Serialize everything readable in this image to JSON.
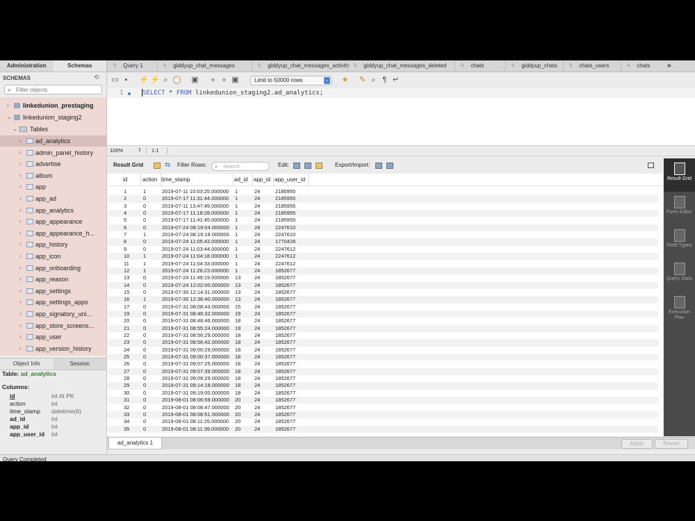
{
  "sidebar": {
    "tabs": [
      "Administration",
      "Schemas"
    ],
    "schemas_header": "SCHEMAS",
    "filter_placeholder": "Filter objects",
    "schemas": [
      "linkedunion_prestaging",
      "linkedunion_staging2"
    ],
    "tables_label": "Tables",
    "tables": [
      "ad_analytics",
      "admin_panel_history",
      "advertise",
      "album",
      "app",
      "app_ad",
      "app_analytics",
      "app_appearance",
      "app_appearance_h...",
      "app_history",
      "app_icon",
      "app_onboarding",
      "app_reason",
      "app_settings",
      "app_settings_apps",
      "app_signatory_uni...",
      "app_store_screens...",
      "app_user",
      "app_version_history"
    ],
    "selected_table": "ad_analytics"
  },
  "info": {
    "tabs": [
      "Object Info",
      "Session"
    ],
    "table_label": "Table:",
    "table_name": "ad_analytics",
    "columns_label": "Columns:",
    "columns": [
      {
        "name": "id",
        "type": "int AI PK"
      },
      {
        "name": "action",
        "type": "int"
      },
      {
        "name": "time_stamp",
        "type": "datetime(6)"
      },
      {
        "name": "ad_id",
        "type": "int"
      },
      {
        "name": "app_id",
        "type": "int"
      },
      {
        "name": "app_user_id",
        "type": "int"
      }
    ]
  },
  "query_tabs": [
    "Query 1",
    "giddyup_chat_messages",
    "giddyup_chat_messages_activity",
    "giddyup_chat_messages_deleted",
    "chats",
    "giddyup_chats",
    "chats_users",
    "chats"
  ],
  "more_tabs_glyph": "»",
  "toolbar": {
    "limit_label": "Limit to 50000 rows"
  },
  "editor": {
    "line_number": "1",
    "sql_keyword1": "SELECT",
    "sql_star": " * ",
    "sql_keyword2": "FROM",
    "sql_rest": " linkedunion_staging2.ad_analytics;"
  },
  "editor_status": {
    "zoom": "100%",
    "position": "1:1"
  },
  "result_toolbar": {
    "result_grid": "Result Grid",
    "filter_rows": "Filter Rows:",
    "search_placeholder": "Search",
    "edit": "Edit:",
    "export_import": "Export/Import:"
  },
  "right_panel": [
    {
      "label": "Result Grid",
      "icon": "result-grid-icon"
    },
    {
      "label": "Form Editor",
      "icon": "form-editor-icon"
    },
    {
      "label": "Field Types",
      "icon": "field-types-icon"
    },
    {
      "label": "Query Stats",
      "icon": "query-stats-icon"
    },
    {
      "label": "Execution Plan",
      "icon": "execution-plan-icon"
    }
  ],
  "grid": {
    "columns": [
      "id",
      "action",
      "time_stamp",
      "ad_id",
      "app_id",
      "app_user_id"
    ],
    "rows": [
      [
        "1",
        "1",
        "2019-07-11 10:03:25.000000",
        "1",
        "24",
        "2185955"
      ],
      [
        "2",
        "0",
        "2019-07-17 11:31:44.000000",
        "1",
        "24",
        "2185955"
      ],
      [
        "3",
        "0",
        "2019-07-11 13:47:49.000000",
        "1",
        "24",
        "2185955"
      ],
      [
        "4",
        "0",
        "2019-07-17 11:18:28.000000",
        "1",
        "24",
        "2185955"
      ],
      [
        "5",
        "0",
        "2019-07-17 11:41:45.000000",
        "1",
        "24",
        "2185955"
      ],
      [
        "6",
        "0",
        "2019-07-24 08:19:04.000000",
        "1",
        "24",
        "2247610"
      ],
      [
        "7",
        "1",
        "2019-07-24 08:19:18.000000",
        "1",
        "24",
        "2247610"
      ],
      [
        "8",
        "0",
        "2019-07-24 11:05:43.000000",
        "1",
        "24",
        "1770428"
      ],
      [
        "9",
        "0",
        "2019-07-24 11:03:44.000000",
        "1",
        "24",
        "2247612"
      ],
      [
        "10",
        "1",
        "2019-07-24 11:04:18.000000",
        "1",
        "24",
        "2247612"
      ],
      [
        "11",
        "1",
        "2019-07-24 11:04:33.000000",
        "1",
        "24",
        "2247612"
      ],
      [
        "12",
        "1",
        "2019-07-24 11:26:23.000000",
        "1",
        "24",
        "1852677"
      ],
      [
        "13",
        "0",
        "2019-07-24 11:49:19.000000",
        "13",
        "24",
        "1852677"
      ],
      [
        "14",
        "0",
        "2019-07-24 12:02:00.000000",
        "13",
        "24",
        "1852677"
      ],
      [
        "15",
        "0",
        "2019-07-30 12:14:31.000000",
        "13",
        "24",
        "1852677"
      ],
      [
        "16",
        "1",
        "2019-07-30 12:36:40.000000",
        "13",
        "24",
        "1852677"
      ],
      [
        "17",
        "0",
        "2019-07-31 08:08:43.000000",
        "15",
        "24",
        "1852677"
      ],
      [
        "19",
        "0",
        "2019-07-31 08:46:32.000000",
        "19",
        "24",
        "1852677"
      ],
      [
        "20",
        "0",
        "2019-07-31 08:48:46.000000",
        "18",
        "24",
        "1852677"
      ],
      [
        "21",
        "0",
        "2019-07-31 08:55:24.000000",
        "19",
        "24",
        "1852677"
      ],
      [
        "22",
        "0",
        "2019-07-31 08:56:29.000000",
        "18",
        "24",
        "1852677"
      ],
      [
        "23",
        "0",
        "2019-07-31 08:56:42.000000",
        "18",
        "24",
        "1852677"
      ],
      [
        "24",
        "0",
        "2019-07-31 09:00:29.000000",
        "18",
        "24",
        "1852677"
      ],
      [
        "25",
        "0",
        "2019-07-31 09:00:37.000000",
        "18",
        "24",
        "1852677"
      ],
      [
        "26",
        "0",
        "2019-07-31 09:07:25.000000",
        "18",
        "24",
        "1852677"
      ],
      [
        "27",
        "0",
        "2019-07-31 09:07:39.000000",
        "18",
        "24",
        "1852677"
      ],
      [
        "28",
        "0",
        "2019-07-31 09:09:29.000000",
        "18",
        "24",
        "1852677"
      ],
      [
        "29",
        "0",
        "2019-07-31 09:14:18.000000",
        "18",
        "24",
        "1852677"
      ],
      [
        "30",
        "0",
        "2019-07-31 09:19:00.000000",
        "18",
        "24",
        "1852677"
      ],
      [
        "31",
        "0",
        "2019-08-01 08:06:59.000000",
        "20",
        "24",
        "1852677"
      ],
      [
        "32",
        "0",
        "2019-08-01 08:08:47.000000",
        "20",
        "24",
        "1852677"
      ],
      [
        "33",
        "0",
        "2019-08-01 08:08:51.000000",
        "20",
        "24",
        "1852677"
      ],
      [
        "34",
        "0",
        "2019-08-01 08:11:25.000000",
        "20",
        "24",
        "1852677"
      ],
      [
        "35",
        "0",
        "2019-08-01 08:11:39.000000",
        "20",
        "24",
        "1852677"
      ]
    ]
  },
  "result_tab": "ad_analytics 1",
  "buttons": {
    "apply": "Apply",
    "revert": "Revert"
  },
  "status": "Query Completed"
}
